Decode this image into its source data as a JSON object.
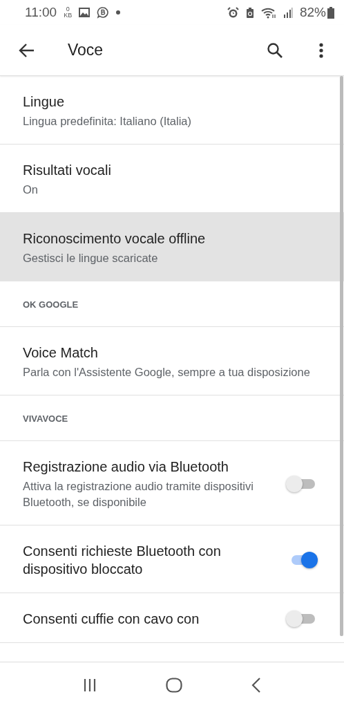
{
  "status_bar": {
    "time": "11:00",
    "data_speed_value": "0",
    "data_speed_unit": "KB",
    "battery": "82%"
  },
  "app_bar": {
    "title": "Voce"
  },
  "items": [
    {
      "kind": "setting",
      "title": "Lingue",
      "summary": "Lingua predefinita: Italiano (Italia)",
      "highlighted": false
    },
    {
      "kind": "setting",
      "title": "Risultati vocali",
      "summary": "On",
      "highlighted": false
    },
    {
      "kind": "setting",
      "title": "Riconoscimento vocale offline",
      "summary": "Gestisci le lingue scaricate",
      "highlighted": true
    },
    {
      "kind": "header",
      "title": "OK GOOGLE"
    },
    {
      "kind": "setting",
      "title": "Voice Match",
      "summary": "Parla con l'Assistente Google, sempre a tua disposizione",
      "highlighted": false
    },
    {
      "kind": "header",
      "title": "VIVAVOCE"
    },
    {
      "kind": "switch",
      "title": "Registrazione audio via Bluetooth",
      "summary": "Attiva la registrazione audio tramite dispositivi Bluetooth, se disponibile",
      "highlighted": false,
      "on": false
    },
    {
      "kind": "switch",
      "title": "Consenti richieste Bluetooth con dispositivo bloccato",
      "highlighted": false,
      "on": true
    },
    {
      "kind": "switch",
      "title": "Consenti cuffie con cavo con",
      "highlighted": false,
      "on": false
    }
  ]
}
